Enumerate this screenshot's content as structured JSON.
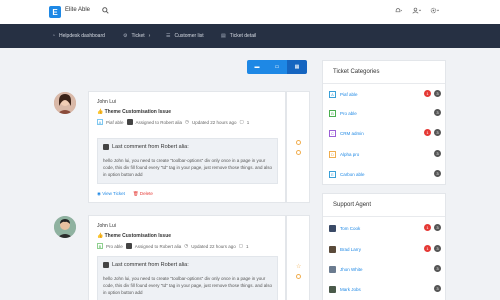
{
  "topbar": {
    "logo_letter": "E",
    "brand": "Elite Able",
    "search_icon": "search-icon",
    "icons": [
      "bell-icon",
      "user-icon",
      "gear-icon"
    ]
  },
  "navbar": {
    "items": [
      {
        "icon": "dashboard-icon",
        "label": "Helpdesk dashboard"
      },
      {
        "icon": "ticket-icon",
        "label": "Ticket"
      },
      {
        "icon": "list-icon",
        "label": "Customer list"
      },
      {
        "icon": "document-icon",
        "label": "Ticket detail"
      }
    ]
  },
  "view_buttons": [
    "list-view-icon",
    "card-view-icon",
    "grid-view-icon"
  ],
  "tickets": [
    {
      "name": "John Lui",
      "title": "Theme Customisation Issue",
      "product": "Piaf able",
      "assigned": "Assigned to Robert alia",
      "updated": "Updated 22 hours ago",
      "comments": "1",
      "comment_head": "Last comment from Robert alia:",
      "comment_body": "hello John lui, you need to create \"toolbar-options\" div only once in a page in your code, this div fill found every \"td\" tag in your page, just remove those things. and also in option button add",
      "view": "View Ticket",
      "delete": "Delete"
    },
    {
      "name": "John Lui",
      "title": "Theme Customisation Issue",
      "product": "Pro able",
      "assigned": "Assigned to Robert alia",
      "updated": "Updated 22 hours ago",
      "comments": "1",
      "comment_head": "Last comment from Robert alia:",
      "comment_body": "hello John lui, you need to create \"toolbar-options\" div only once in a page in your code, this div fill found every \"td\" tag in your page, just remove those things. and also in option button add"
    }
  ],
  "categories": {
    "title": "Ticket Categories",
    "items": [
      {
        "letter": "A",
        "label": "Piaf able",
        "color": "#3aa0d8",
        "red": "1",
        "count": "3"
      },
      {
        "letter": "B",
        "label": "Pro able",
        "color": "#4caf50",
        "count": "3"
      },
      {
        "letter": "C",
        "label": "CRM admin",
        "color": "#9c5fd6",
        "red": "1",
        "count": "3"
      },
      {
        "letter": "D",
        "label": "Alpha pro",
        "color": "#f0ad4e",
        "count": "3"
      },
      {
        "letter": "E",
        "label": "Carbon able",
        "color": "#3aa0d8",
        "count": "3"
      }
    ]
  },
  "agents": {
    "title": "Support Agent",
    "items": [
      {
        "label": "Tom Cook",
        "red": "1",
        "count": "3"
      },
      {
        "label": "Brad Larry",
        "red": "1",
        "count": "3"
      },
      {
        "label": "Jhon White",
        "count": "3"
      },
      {
        "label": "Mark Jobs",
        "count": "3"
      }
    ]
  }
}
